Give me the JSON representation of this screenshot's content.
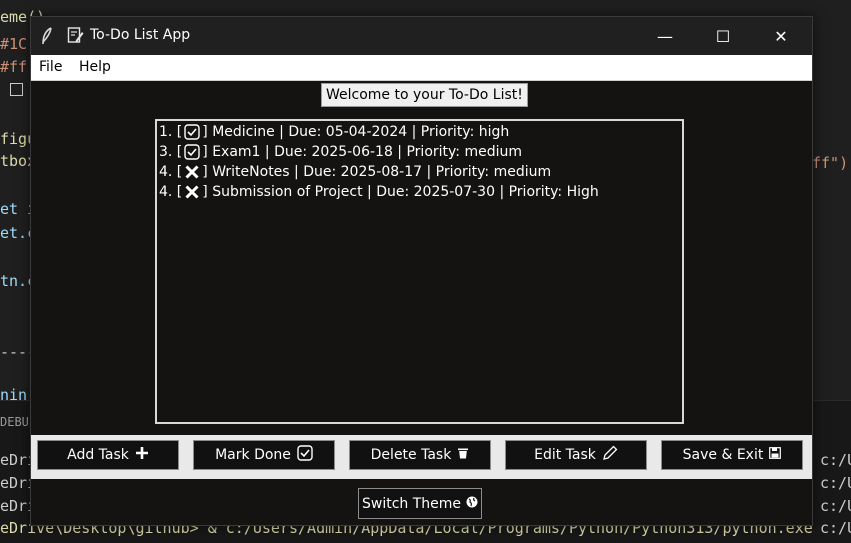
{
  "background": {
    "code_lines": [
      "eme()",
      "#1C",
      "#ff",
      "'",
      "figu",
      "tbox",
      "et i",
      "et.c",
      "tn.c",
      "-----",
      "nin"
    ],
    "right_code": "ff\")",
    "panel_label": "DEBU",
    "terminal_lines": [
      "eDri",
      "eDri",
      "eDri",
      "eDrive\\Desktop\\github> & c:/Users/Admin/AppData/Local/Programs/Python/Python313/python.exe"
    ],
    "terminal_right": [
      "c:/U",
      "c:/U",
      "c:/U",
      "c:/U"
    ]
  },
  "window": {
    "title": "To-Do List App",
    "minimize_glyph": "—",
    "maximize_glyph": "☐",
    "close_glyph": "✕"
  },
  "menu": [
    "File",
    "Help"
  ],
  "welcome_text": "Welcome to your To-Do List!",
  "tasks": [
    {
      "prefix": "1. [",
      "status": "done",
      "suffix": "] Medicine | Due: 05-04-2024 | Priority: high"
    },
    {
      "prefix": "3. [",
      "status": "done",
      "suffix": "] Exam1 | Due: 2025-06-18 | Priority: medium"
    },
    {
      "prefix": "4. [",
      "status": "pending",
      "suffix": "] WriteNotes | Due: 2025-08-17 | Priority: medium"
    },
    {
      "prefix": "4. [",
      "status": "pending",
      "suffix": "] Submission of Project | Due: 2025-07-30 | Priority: High"
    }
  ],
  "buttons": [
    {
      "label": "Add Task",
      "icon": "plus-icon"
    },
    {
      "label": "Mark Done",
      "icon": "checkbox-icon"
    },
    {
      "label": "Delete Task",
      "icon": "trash-icon"
    },
    {
      "label": "Edit Task",
      "icon": "pencil-icon"
    },
    {
      "label": "Save & Exit",
      "icon": "floppy-disk-icon"
    }
  ],
  "switch_theme": {
    "label": "Switch Theme",
    "icon": "globe-icon"
  },
  "colors": {
    "window_bg": "#151212",
    "button_bg": "#111111",
    "titlebar_bg": "#202020"
  }
}
